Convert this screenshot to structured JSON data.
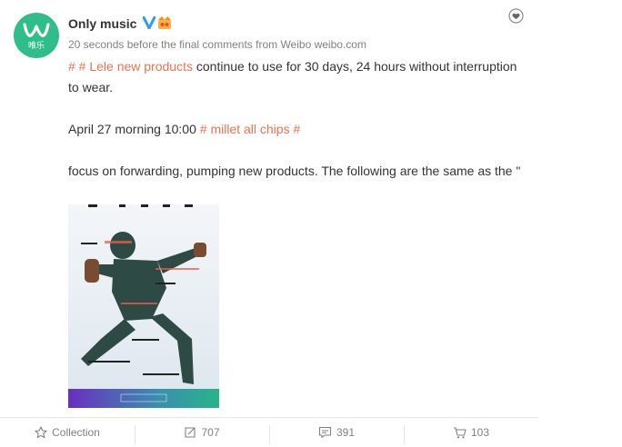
{
  "post": {
    "username": "Only music",
    "avatar_text": "唯乐",
    "meta_time": "20 seconds before the final comments from Weibo",
    "meta_source": "weibo.com",
    "para1_topic": "# # Lele new products",
    "para1_text": " continue to use for 30 days, 24 hours without interruption to wear.",
    "para2_text": "April 27 morning 10:00 ",
    "para2_topic": "# millet all chips #",
    "para3_text": "focus on forwarding, pumping new products. The following are the same as the \""
  },
  "toolbar": {
    "collection_label": "Collection",
    "forward_count": "707",
    "comment_count": "391",
    "like_count": "103"
  },
  "colors": {
    "accent_link": "#eb7350",
    "verified": "#2b9cf2",
    "avatar_bg": "#2fbd8b"
  },
  "icons": [
    "follow-icon",
    "verified-icon",
    "vip-badge-icon",
    "star-icon",
    "forward-icon",
    "comment-icon",
    "like-icon"
  ]
}
